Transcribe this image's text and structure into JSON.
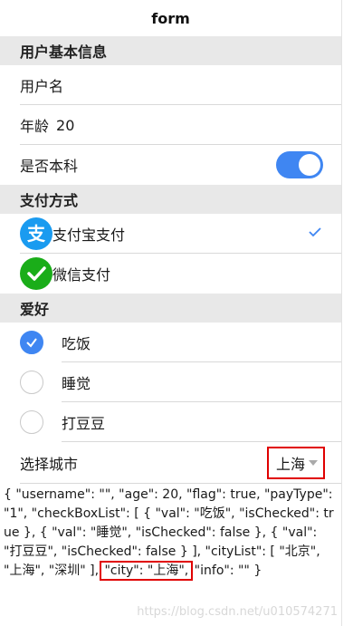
{
  "nav": {
    "title": "form"
  },
  "sections": {
    "basic": "用户基本信息",
    "pay": "支付方式",
    "hobby": "爱好"
  },
  "fields": {
    "username_label": "用户名",
    "age_label": "年龄",
    "age_value": "20",
    "undergrad_label": "是否本科",
    "undergrad_on": true
  },
  "pay": {
    "options": [
      {
        "label": "支付宝支付",
        "icon": "alipay-icon",
        "selected": true
      },
      {
        "label": "微信支付",
        "icon": "wechat-icon",
        "selected": false
      }
    ]
  },
  "hobbies": [
    {
      "label": "吃饭",
      "checked": true
    },
    {
      "label": "睡觉",
      "checked": false
    },
    {
      "label": "打豆豆",
      "checked": false
    }
  ],
  "city": {
    "label": "选择城市",
    "value": "上海"
  },
  "json_output": {
    "before": "{ \"username\": \"\", \"age\": 20, \"flag\": true, \"payType\": \"1\", \"checkBoxList\": [ { \"val\": \"吃饭\", \"isChecked\": true }, { \"val\": \"睡觉\", \"isChecked\": false }, { \"val\": \"打豆豆\", \"isChecked\": false } ], \"cityList\": [ \"北京\", \"上海\", \"深圳\" ], ",
    "highlight": "\"city\": \"上海\",",
    "after": " \"info\": \"\" }"
  },
  "watermark": "https://blog.csdn.net/u010574271",
  "colors": {
    "accent": "#3f86f2",
    "alipay": "#1a9bf0",
    "wechat": "#1aad19",
    "highlight_border": "#e00000"
  }
}
